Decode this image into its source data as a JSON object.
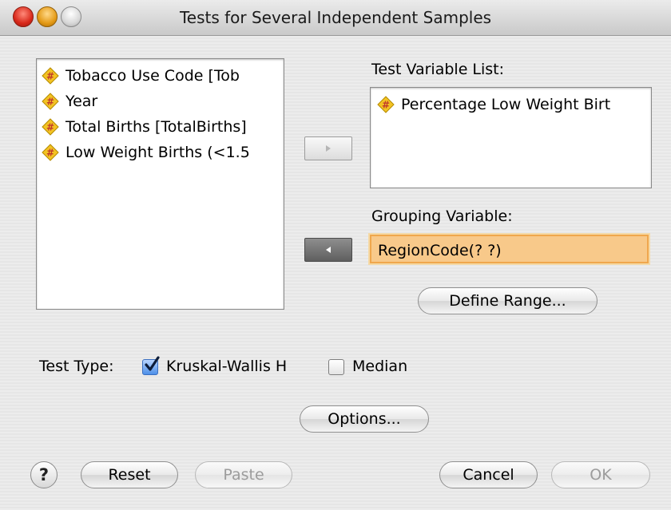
{
  "window": {
    "title": "Tests for Several Independent Samples"
  },
  "source_list": {
    "items": [
      {
        "label": "Tobacco Use Code [Tob",
        "icon": "scale-variable-icon"
      },
      {
        "label": "Year",
        "icon": "scale-variable-icon"
      },
      {
        "label": "Total Births [TotalBirths]",
        "icon": "scale-variable-icon"
      },
      {
        "label": "Low Weight Births (<1.5",
        "icon": "scale-variable-icon"
      }
    ]
  },
  "test_variables": {
    "heading": "Test Variable List:",
    "items": [
      {
        "label": "Percentage Low Weight Birt",
        "icon": "scale-variable-icon"
      }
    ]
  },
  "grouping": {
    "heading": "Grouping Variable:",
    "value": "RegionCode(? ?)",
    "define_range_label": "Define Range..."
  },
  "test_type": {
    "heading": "Test Type:",
    "options": [
      {
        "label": "Kruskal-Wallis H",
        "checked": true
      },
      {
        "label": "Median",
        "checked": false
      }
    ]
  },
  "buttons": {
    "options": "Options...",
    "help": "?",
    "reset": "Reset",
    "paste": "Paste",
    "cancel": "Cancel",
    "ok": "OK"
  },
  "colors": {
    "grouping_highlight": "#f8c98a",
    "checkbox_accent": "#4d8fe8",
    "variable_icon": "#f3c323"
  }
}
